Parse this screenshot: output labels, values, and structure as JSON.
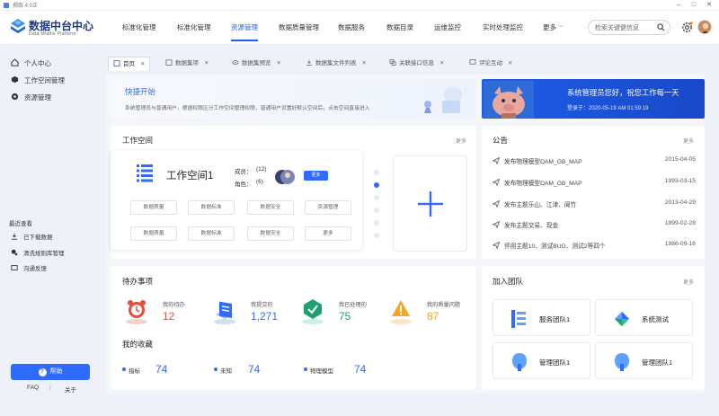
{
  "window": {
    "title": "揭取 4.0正"
  },
  "app": {
    "name": "数据中台中心",
    "subtitle": "Data Middle Platform"
  },
  "nav": {
    "items": [
      "标准化管理",
      "标准化管理",
      "资源管理",
      "数据质量管理",
      "数据服务",
      "数据目录",
      "运维监控",
      "实时处理监控",
      "更多"
    ],
    "active_index": 2
  },
  "search": {
    "placeholder": "检索关键健信息"
  },
  "sidebar": {
    "items": [
      "个人中心",
      "工作空间管理",
      "资源管理"
    ],
    "recent_title": "最近查看",
    "recent": [
      "已下载数据",
      "清洗规则库管理",
      "沟通反馈"
    ],
    "help": "帮助",
    "faq": "FAQ",
    "sep": "|",
    "about": "关于"
  },
  "tabs": [
    "首页",
    "数据集项",
    "数据集预览",
    "数据集文件列表",
    "关联接口信息",
    "评论互动"
  ],
  "quick_start": {
    "title": "快捷开始",
    "desc": "系统管理员与普通用户，根据权限区分工作空间管理权限，普通用户设置好默认空间后，点击空间直接进入"
  },
  "banner": {
    "welcome": "系统管理员您好，祝您工作每一天",
    "login_time": "登录于：2020-05-19 AM 01:59:19"
  },
  "workspace": {
    "title": "工作空间",
    "more": "更多",
    "name": "工作空间1",
    "members_label": "成员：",
    "members": "(12)",
    "roles_label": "角色：",
    "roles": "(6)",
    "more_btn": "更多",
    "pills": [
      "数据质量",
      "数据标准",
      "数据安全",
      "资源管理",
      "数据质量",
      "数据标准",
      "数据安全",
      "更多"
    ],
    "pager_active": 1
  },
  "notice": {
    "title": "公告",
    "more": "更多",
    "items": [
      {
        "text": "发布物理模型DAM_GB_MAP",
        "date": "2015-04-05"
      },
      {
        "text": "发布物理模型DAM_GB_MAP",
        "date": "1993-03-15"
      },
      {
        "text": "发布主题乐山、江津、阆竹",
        "date": "2013-04-29"
      },
      {
        "text": "发布主题交易、现金",
        "date": "1999-02-28"
      },
      {
        "text": "停用主题10、测试BUG、测试2等四个",
        "date": "1986-09-16"
      }
    ]
  },
  "todo": {
    "title": "待办事项",
    "items": [
      {
        "label": "我的待办",
        "value": "12",
        "color": "#e84c3d"
      },
      {
        "label": "我提交的",
        "value": "1,271",
        "color": "#2f6bff"
      },
      {
        "label": "我已处理的",
        "value": "75",
        "color": "#1aa36f"
      },
      {
        "label": "我的质量问题",
        "value": "87",
        "color": "#f5a623"
      }
    ]
  },
  "favorites": {
    "title": "我的收藏",
    "items": [
      {
        "label": "指标",
        "value": "74"
      },
      {
        "label": "未知",
        "value": "74"
      },
      {
        "label": "物理模型",
        "value": "74"
      }
    ]
  },
  "teams": {
    "title": "加入团队",
    "more": "更多",
    "items": [
      "服务团队1",
      "系统测试",
      "管理团队1",
      "管理团队1"
    ]
  }
}
